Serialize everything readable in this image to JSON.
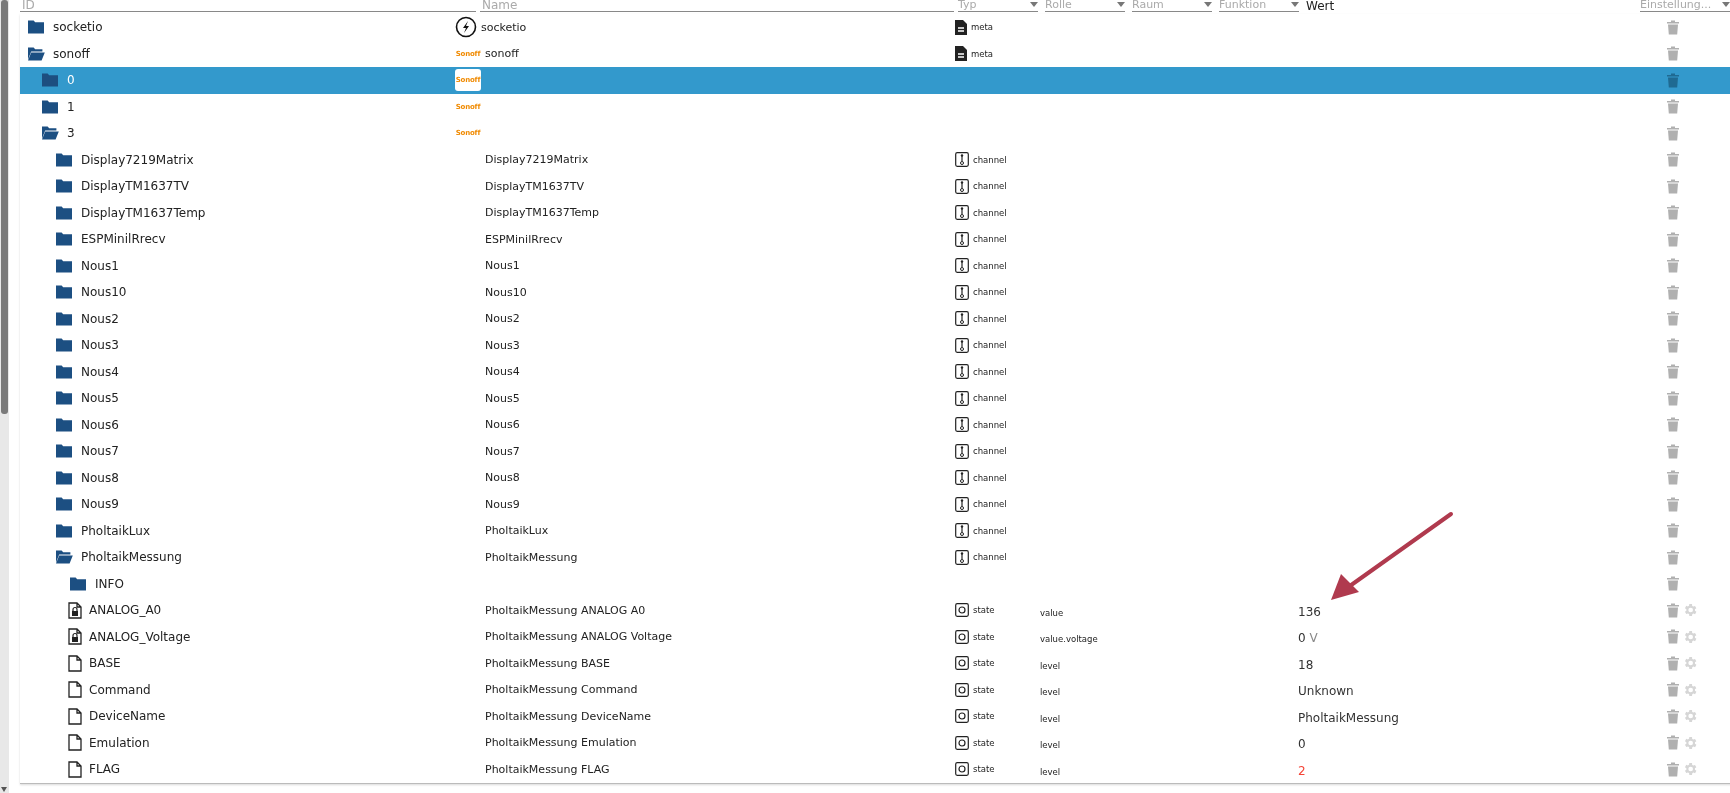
{
  "header": {
    "id_filter": {
      "placeholder": "ID"
    },
    "name_filter": {
      "placeholder": "Name"
    },
    "selects": [
      {
        "label": "Typ"
      },
      {
        "label": "Rolle"
      },
      {
        "label": "Raum"
      },
      {
        "label": "Funktion"
      }
    ],
    "value_label": "Wert",
    "settings_select": {
      "label": "Einstellung..."
    }
  },
  "tree": [
    {
      "kind": "folder",
      "id": "socketio",
      "expanded": false,
      "selected": false,
      "name": {
        "kind": "emblem",
        "text": "socketio"
      },
      "type": {
        "kind": "meta",
        "label": "meta"
      }
    },
    {
      "kind": "folder",
      "id": "sonoff",
      "expanded": true,
      "selected": false,
      "name": {
        "kind": "logo",
        "logo": "Sonoff",
        "text": "sonoff"
      },
      "type": {
        "kind": "meta",
        "label": "meta"
      },
      "children": [
        {
          "kind": "folder",
          "id": "0",
          "expanded": false,
          "selected": true,
          "name": {
            "kind": "logo",
            "logo": "Sonoff"
          }
        },
        {
          "kind": "folder",
          "id": "1",
          "expanded": false,
          "selected": false,
          "name": {
            "kind": "logo",
            "logo": "Sonoff"
          }
        },
        {
          "kind": "folder",
          "id": "3",
          "expanded": true,
          "selected": false,
          "name": {
            "kind": "logo",
            "logo": "Sonoff"
          },
          "children": [
            {
              "kind": "folder",
              "id": "Display7219Matrix",
              "expanded": false,
              "selected": false,
              "name": {
                "text": "Display7219Matrix"
              },
              "type": {
                "kind": "channel",
                "label": "channel"
              }
            },
            {
              "kind": "folder",
              "id": "DisplayTM1637TV",
              "expanded": false,
              "selected": false,
              "name": {
                "text": "DisplayTM1637TV"
              },
              "type": {
                "kind": "channel",
                "label": "channel"
              }
            },
            {
              "kind": "folder",
              "id": "DisplayTM1637Temp",
              "expanded": false,
              "selected": false,
              "name": {
                "text": "DisplayTM1637Temp"
              },
              "type": {
                "kind": "channel",
                "label": "channel"
              }
            },
            {
              "kind": "folder",
              "id": "ESPMinilRrecv",
              "expanded": false,
              "selected": false,
              "name": {
                "text": "ESPMinilRrecv"
              },
              "type": {
                "kind": "channel",
                "label": "channel"
              }
            },
            {
              "kind": "folder",
              "id": "Nous1",
              "expanded": false,
              "selected": false,
              "name": {
                "text": "Nous1"
              },
              "type": {
                "kind": "channel",
                "label": "channel"
              }
            },
            {
              "kind": "folder",
              "id": "Nous10",
              "expanded": false,
              "selected": false,
              "name": {
                "text": "Nous10"
              },
              "type": {
                "kind": "channel",
                "label": "channel"
              }
            },
            {
              "kind": "folder",
              "id": "Nous2",
              "expanded": false,
              "selected": false,
              "name": {
                "text": "Nous2"
              },
              "type": {
                "kind": "channel",
                "label": "channel"
              }
            },
            {
              "kind": "folder",
              "id": "Nous3",
              "expanded": false,
              "selected": false,
              "name": {
                "text": "Nous3"
              },
              "type": {
                "kind": "channel",
                "label": "channel"
              }
            },
            {
              "kind": "folder",
              "id": "Nous4",
              "expanded": false,
              "selected": false,
              "name": {
                "text": "Nous4"
              },
              "type": {
                "kind": "channel",
                "label": "channel"
              }
            },
            {
              "kind": "folder",
              "id": "Nous5",
              "expanded": false,
              "selected": false,
              "name": {
                "text": "Nous5"
              },
              "type": {
                "kind": "channel",
                "label": "channel"
              }
            },
            {
              "kind": "folder",
              "id": "Nous6",
              "expanded": false,
              "selected": false,
              "name": {
                "text": "Nous6"
              },
              "type": {
                "kind": "channel",
                "label": "channel"
              }
            },
            {
              "kind": "folder",
              "id": "Nous7",
              "expanded": false,
              "selected": false,
              "name": {
                "text": "Nous7"
              },
              "type": {
                "kind": "channel",
                "label": "channel"
              }
            },
            {
              "kind": "folder",
              "id": "Nous8",
              "expanded": false,
              "selected": false,
              "name": {
                "text": "Nous8"
              },
              "type": {
                "kind": "channel",
                "label": "channel"
              }
            },
            {
              "kind": "folder",
              "id": "Nous9",
              "expanded": false,
              "selected": false,
              "name": {
                "text": "Nous9"
              },
              "type": {
                "kind": "channel",
                "label": "channel"
              }
            },
            {
              "kind": "folder",
              "id": "PholtaikLux",
              "expanded": false,
              "selected": false,
              "name": {
                "text": "PholtaikLux"
              },
              "type": {
                "kind": "channel",
                "label": "channel"
              }
            },
            {
              "kind": "folder",
              "id": "PholtaikMessung",
              "expanded": true,
              "selected": false,
              "name": {
                "text": "PholtaikMessung"
              },
              "type": {
                "kind": "channel",
                "label": "channel"
              },
              "children": [
                {
                  "kind": "folder",
                  "id": "INFO",
                  "expanded": false,
                  "selected": false
                },
                {
                  "kind": "state",
                  "id": "ANALOG_A0",
                  "locked": true,
                  "selected": false,
                  "name": {
                    "text": "PholtaikMessung ANALOG A0"
                  },
                  "type": {
                    "kind": "state",
                    "label": "state"
                  },
                  "role": "value",
                  "value": "136",
                  "color": "#333333"
                },
                {
                  "kind": "state",
                  "id": "ANALOG_Voltage",
                  "locked": true,
                  "selected": false,
                  "name": {
                    "text": "PholtaikMessung ANALOG Voltage"
                  },
                  "type": {
                    "kind": "state",
                    "label": "state"
                  },
                  "role": "value.voltage",
                  "value": "0",
                  "unit": "V",
                  "color": "#333333"
                },
                {
                  "kind": "state",
                  "id": "BASE",
                  "locked": false,
                  "selected": false,
                  "name": {
                    "text": "PholtaikMessung BASE"
                  },
                  "type": {
                    "kind": "state",
                    "label": "state"
                  },
                  "role": "level",
                  "value": "18",
                  "color": "#333333"
                },
                {
                  "kind": "state",
                  "id": "Command",
                  "locked": false,
                  "selected": false,
                  "name": {
                    "text": "PholtaikMessung Command"
                  },
                  "type": {
                    "kind": "state",
                    "label": "state"
                  },
                  "role": "level",
                  "value": "Unknown",
                  "color": "#333333"
                },
                {
                  "kind": "state",
                  "id": "DeviceName",
                  "locked": false,
                  "selected": false,
                  "name": {
                    "text": "PholtaikMessung DeviceName"
                  },
                  "type": {
                    "kind": "state",
                    "label": "state"
                  },
                  "role": "level",
                  "value": "PholtaikMessung",
                  "color": "#333333"
                },
                {
                  "kind": "state",
                  "id": "Emulation",
                  "locked": false,
                  "selected": false,
                  "name": {
                    "text": "PholtaikMessung Emulation"
                  },
                  "type": {
                    "kind": "state",
                    "label": "state"
                  },
                  "role": "level",
                  "value": "0",
                  "color": "#333333"
                },
                {
                  "kind": "state",
                  "id": "FLAG",
                  "locked": false,
                  "selected": false,
                  "name": {
                    "text": "PholtaikMessung FLAG"
                  },
                  "type": {
                    "kind": "state",
                    "label": "state"
                  },
                  "role": "level",
                  "value": "2",
                  "color": "#f44336"
                }
              ]
            }
          ]
        }
      ]
    }
  ]
}
